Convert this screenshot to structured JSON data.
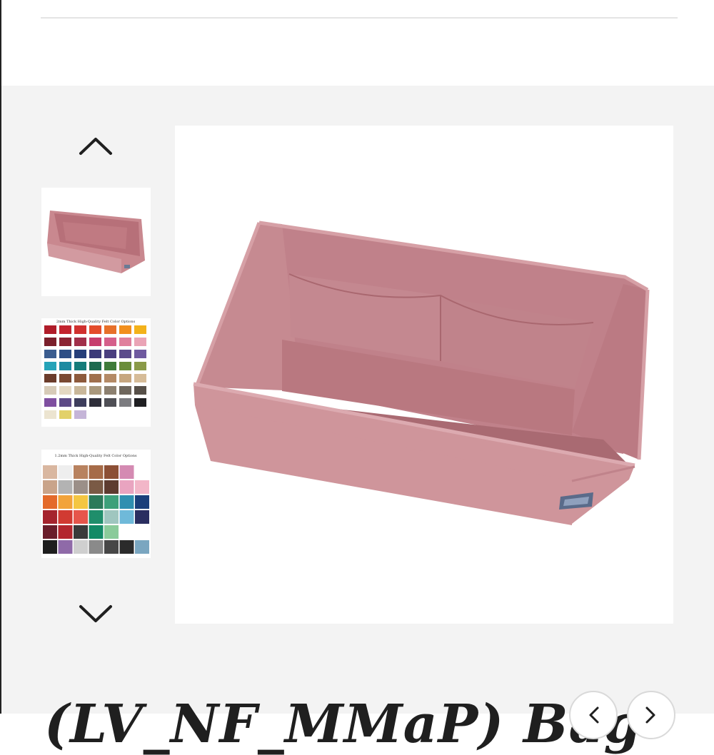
{
  "product": {
    "title": "(LV_NF_MMaP) Bag"
  },
  "gallery": {
    "up_icon": "chevron-up-icon",
    "down_icon": "chevron-down-icon",
    "thumbnails": [
      {
        "caption": ""
      },
      {
        "caption": "2mm Thick High-Quality Felt Color Options"
      },
      {
        "caption": "1.2mm Thick High-Quality Felt Color Options"
      }
    ],
    "prev_icon": "chevron-left-icon",
    "next_icon": "chevron-right-icon"
  },
  "colors": {
    "felt_pink": "#c9888f",
    "felt_pink_dark": "#b77079",
    "felt_pink_light": "#d9a3a8",
    "gallery_bg": "#f3f3f3",
    "title_text": "#1f1f1f"
  }
}
